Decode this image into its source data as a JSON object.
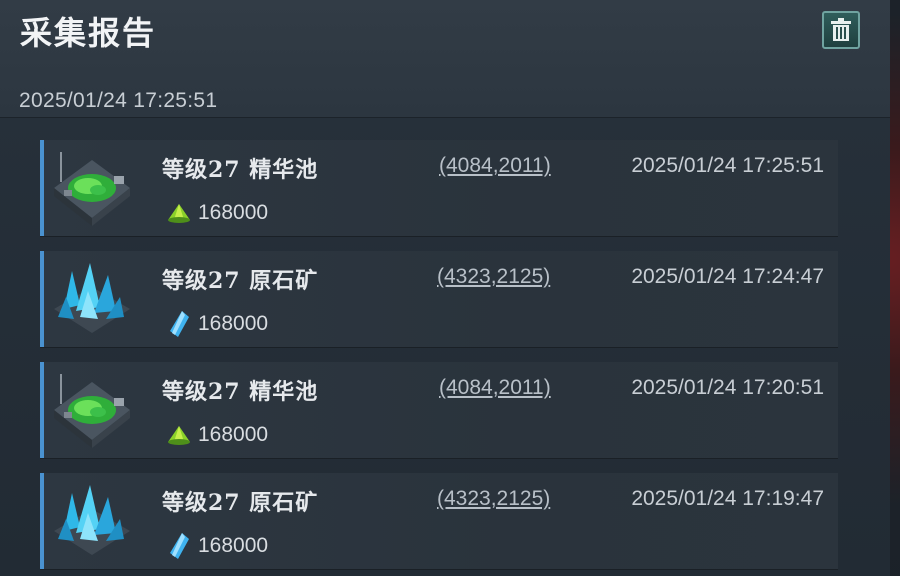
{
  "header": {
    "title": "采集报告",
    "date": "2025/01/24  17:25:51",
    "delete_icon": "trash-icon"
  },
  "reports": [
    {
      "name": "等级27  精华池",
      "coord": "(4084,2011)",
      "time": "2025/01/24 17:25:51",
      "amount": "168000",
      "kind": "essence-pool",
      "resource_icon": "green-essence-icon"
    },
    {
      "name": "等级27  原石矿",
      "coord": "(4323,2125)",
      "time": "2025/01/24 17:24:47",
      "amount": "168000",
      "kind": "crystal-mine",
      "resource_icon": "blue-crystal-icon"
    },
    {
      "name": "等级27  精华池",
      "coord": "(4084,2011)",
      "time": "2025/01/24 17:20:51",
      "amount": "168000",
      "kind": "essence-pool",
      "resource_icon": "green-essence-icon"
    },
    {
      "name": "等级27  原石矿",
      "coord": "(4323,2125)",
      "time": "2025/01/24 17:19:47",
      "amount": "168000",
      "kind": "crystal-mine",
      "resource_icon": "blue-crystal-icon"
    }
  ],
  "colors": {
    "accent_bar": "#4a92d0",
    "delete_button": "#2f5d5b"
  }
}
